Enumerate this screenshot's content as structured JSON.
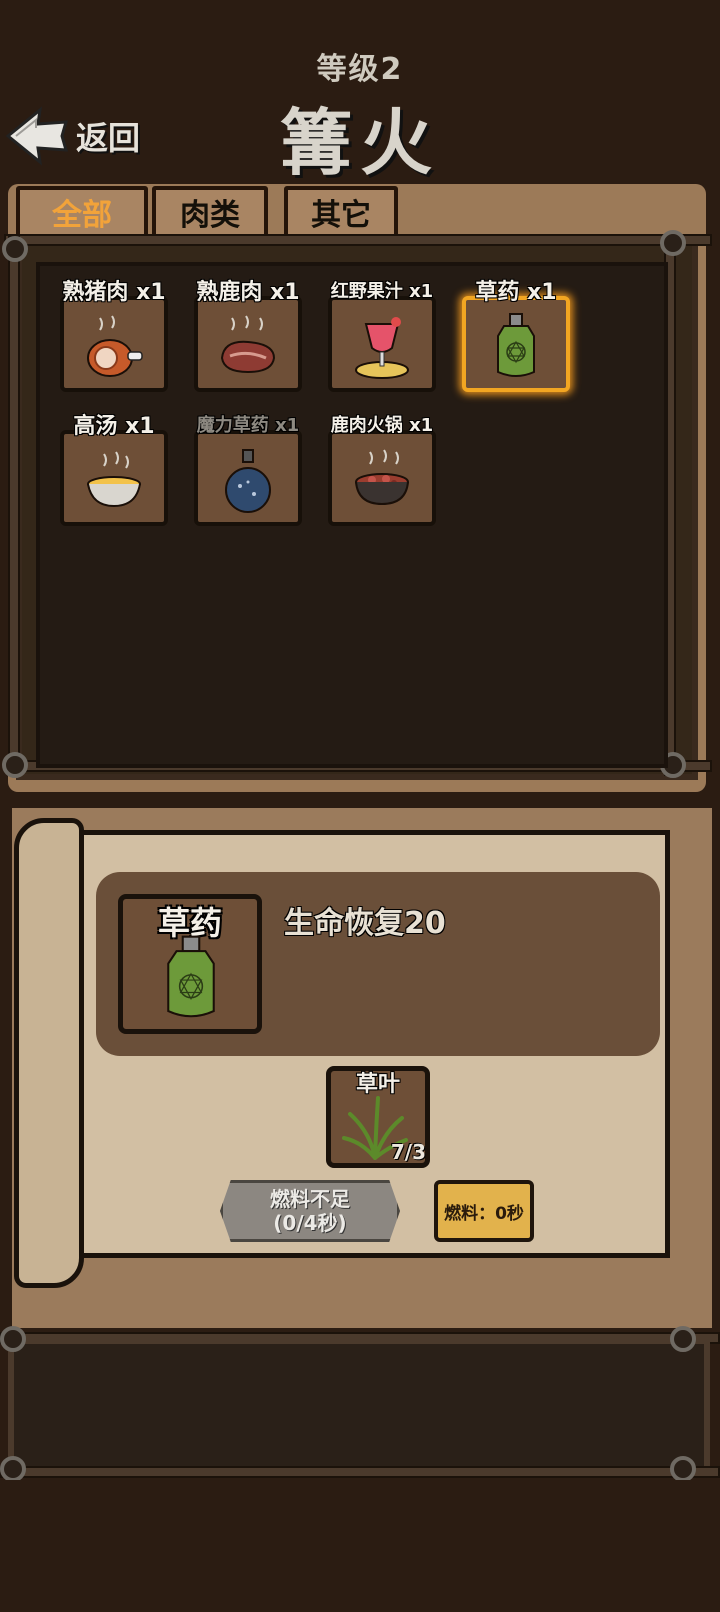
{
  "header": {
    "level": "等级2",
    "title": "篝火",
    "back_label": "返回"
  },
  "tabs": [
    {
      "label": "全部",
      "active": true
    },
    {
      "label": "肉类",
      "active": false
    },
    {
      "label": "其它",
      "active": false
    }
  ],
  "items": [
    {
      "label": "熟猪肉 x1",
      "icon": "roast-ham-icon"
    },
    {
      "label": "熟鹿肉 x1",
      "icon": "steak-icon"
    },
    {
      "label": "红野果汁 x1",
      "icon": "juice-glass-icon"
    },
    {
      "label": "草药 x1",
      "icon": "herb-potion-icon",
      "selected": true
    },
    {
      "label": "高汤 x1",
      "icon": "soup-bowl-icon"
    },
    {
      "label": "魔力草药 x1",
      "icon": "mana-potion-icon",
      "disabled": true
    },
    {
      "label": "鹿肉火锅 x1",
      "icon": "hotpot-icon"
    }
  ],
  "detail": {
    "name": "草药",
    "effect": "生命恢复20",
    "ingredient": {
      "name": "草叶",
      "count": "7/3",
      "icon": "grass-leaf-icon"
    },
    "cook_button": {
      "line1": "燃料不足",
      "line2": "(0/4秒)"
    },
    "fuel_button": "燃料：0秒"
  },
  "colors": {
    "accent_tab": "#f2a33a",
    "selected_glow": "#f2a622",
    "fuel_button": "#e2b24c"
  }
}
